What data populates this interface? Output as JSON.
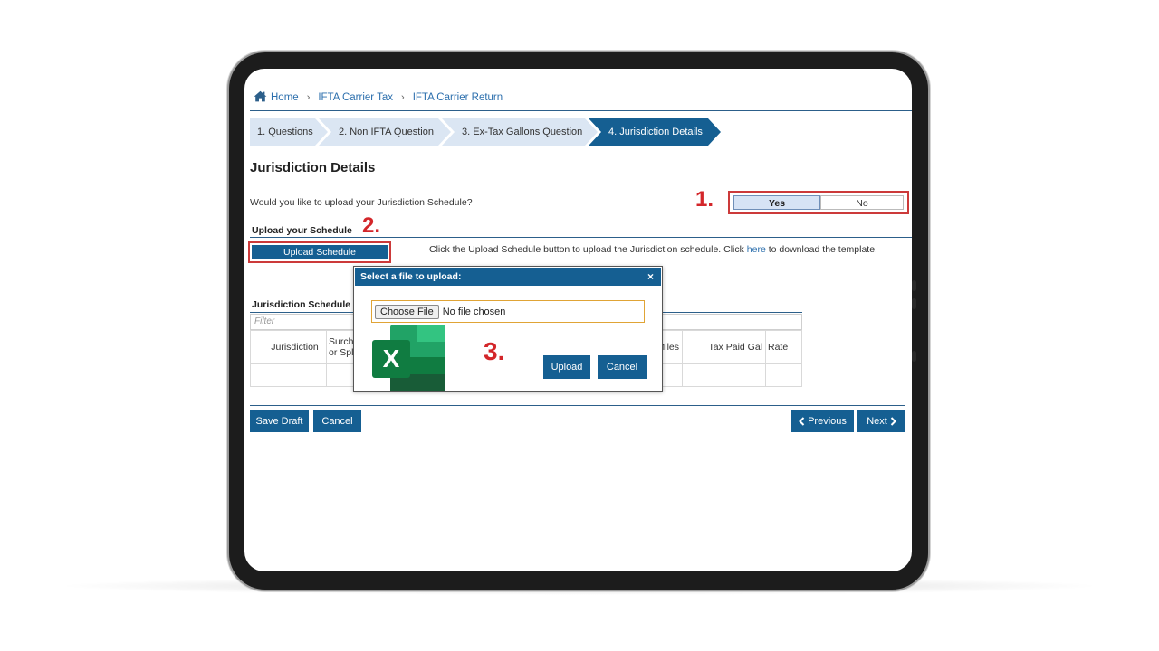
{
  "breadcrumb": {
    "home": "Home",
    "item1": "IFTA Carrier Tax",
    "item2": "IFTA Carrier Return",
    "separator": "›"
  },
  "steps": [
    "1. Questions",
    "2. Non IFTA Question",
    "3. Ex-Tax Gallons Question",
    "4. Jurisdiction Details"
  ],
  "page": {
    "title": "Jurisdiction Details",
    "question": "Would you like to upload your Jurisdiction Schedule?",
    "yes": "Yes",
    "no": "No",
    "upload_heading": "Upload your Schedule",
    "upload_button": "Upload Schedule",
    "instruction_pre": "Click the Upload Schedule button to upload the Jurisdiction schedule. Click ",
    "instruction_link": "here",
    "instruction_post": " to download the template.",
    "schedule_title": "Jurisdiction Schedule",
    "filter_placeholder": "Filter"
  },
  "table": {
    "col_jurisdiction": "Jurisdiction",
    "col_surcharge_line1": "Surch",
    "col_surcharge_line2": "or Spl",
    "col_miles": "Miles",
    "col_tax_paid": "Tax Paid Gal",
    "col_rate": "Rate"
  },
  "actions": {
    "save_draft": "Save Draft",
    "cancel": "Cancel",
    "previous": "Previous",
    "next": "Next"
  },
  "modal": {
    "title": "Select a file to upload:",
    "close": "×",
    "choose_file": "Choose File",
    "no_file": "No file chosen",
    "upload": "Upload",
    "cancel": "Cancel",
    "excel_letter": "X"
  },
  "callouts": {
    "one": "1.",
    "two": "2.",
    "three": "3."
  },
  "colors": {
    "primary": "#155f92",
    "step_inactive": "#dbe6f3",
    "link": "#2c6fad",
    "callout": "#d3262a",
    "highlight_border": "#cc3a3a"
  },
  "icons": {
    "home": "home-icon",
    "close": "close-icon",
    "excel": "excel-icon",
    "chevron_left": "chevron-left-icon",
    "chevron_right": "chevron-right-icon"
  }
}
